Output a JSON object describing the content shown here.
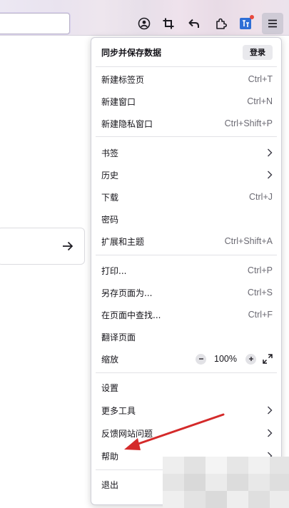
{
  "colors": {
    "accent": "#cfcbd6",
    "annotation_arrow": "#d42a2a",
    "badge": "#e8493d"
  },
  "toolbar": {
    "buttons": [
      {
        "name": "account-icon"
      },
      {
        "name": "crop-screenshot-icon"
      },
      {
        "name": "undo-icon"
      },
      {
        "name": "extensions-icon"
      },
      {
        "name": "translate-extension-icon"
      },
      {
        "name": "hamburger-menu-icon"
      }
    ]
  },
  "menu": {
    "sync": {
      "label": "同步并保存数据",
      "login_button": "登录"
    },
    "groups": [
      [
        {
          "label": "新建标签页",
          "shortcut": "Ctrl+T"
        },
        {
          "label": "新建窗口",
          "shortcut": "Ctrl+N"
        },
        {
          "label": "新建隐私窗口",
          "shortcut": "Ctrl+Shift+P"
        }
      ],
      [
        {
          "label": "书签",
          "submenu": true
        },
        {
          "label": "历史",
          "submenu": true
        },
        {
          "label": "下载",
          "shortcut": "Ctrl+J"
        },
        {
          "label": "密码"
        },
        {
          "label": "扩展和主题",
          "shortcut": "Ctrl+Shift+A"
        }
      ],
      [
        {
          "label": "打印...",
          "shortcut": "Ctrl+P"
        },
        {
          "label": "另存页面为...",
          "shortcut": "Ctrl+S"
        },
        {
          "label": "在页面中查找...",
          "shortcut": "Ctrl+F"
        },
        {
          "label": "翻译页面"
        }
      ]
    ],
    "zoom": {
      "label": "缩放",
      "decrease": "−",
      "value": "100%",
      "increase": "+"
    },
    "settings": [
      {
        "label": "设置"
      },
      {
        "label": "更多工具",
        "submenu": true
      },
      {
        "label": "反馈网站问题",
        "submenu": true
      },
      {
        "label": "帮助",
        "submenu": true
      }
    ],
    "exit": {
      "label": "退出"
    }
  }
}
